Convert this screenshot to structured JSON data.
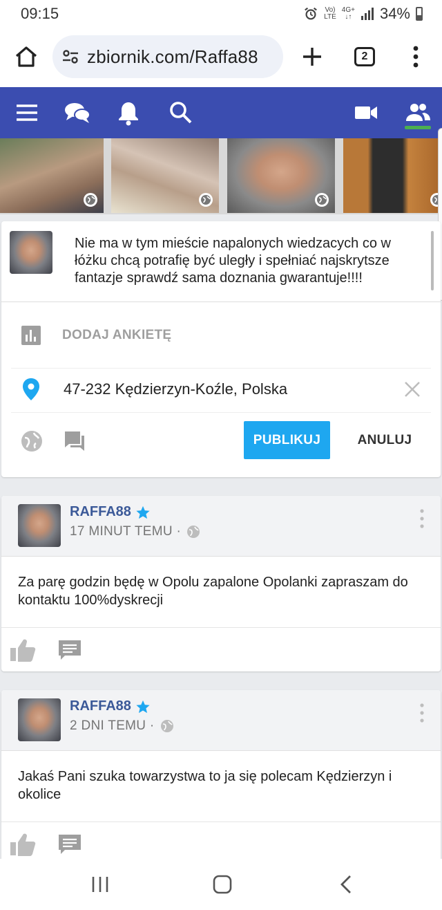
{
  "status_bar": {
    "time": "09:15",
    "network_top": "Vo)",
    "network_bottom": "LTE",
    "data_top": "4G+",
    "battery": "34%"
  },
  "browser": {
    "url": "zbiornik.com/Raffa88",
    "tab_count": "2",
    "icons": [
      "home-icon",
      "site-settings-icon",
      "plus-icon",
      "tabs-icon",
      "overflow-menu-icon"
    ]
  },
  "app_nav": {
    "icons": [
      "menu-icon",
      "chat-icon",
      "bell-icon",
      "search-icon",
      "video-icon",
      "friends-icon"
    ],
    "accent": "#3b4db0",
    "active_indicator": "#4caf50"
  },
  "composer": {
    "text": "Nie ma w tym mieście napalonych wiedzacych co w łóżku chcą potrafię być uległy i spełniać najskrytsze fantazje sprawdź sama doznania gwarantuje!!!!",
    "poll_label": "DODAJ ANKIETĘ",
    "location": "47-232 Kędzierzyn-Koźle, Polska",
    "publish_label": "PUBLIKUJ",
    "cancel_label": "ANULUJ",
    "publish_color": "#1ea7f0"
  },
  "posts": [
    {
      "author": "RAFFA88",
      "time": "17 MINUT TEMU ·",
      "text": "Za parę godzin będę w Opolu zapalone Opolanki zapraszam do kontaktu 100%dyskrecji"
    },
    {
      "author": "RAFFA88",
      "time": "2 DNI TEMU ·",
      "text": "Jakaś Pani szuka towarzystwa to ja się polecam Kędzierzyn i okolice"
    }
  ],
  "system_nav": [
    "recents-icon",
    "home-icon",
    "back-icon"
  ]
}
